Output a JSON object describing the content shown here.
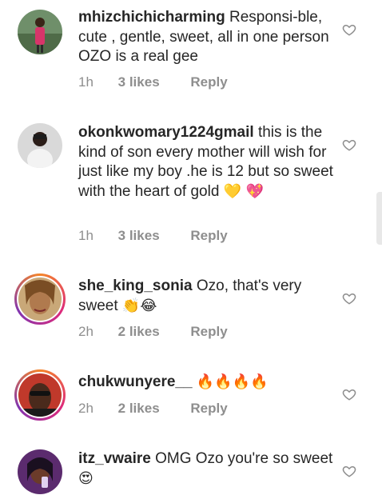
{
  "comments": [
    {
      "username": "mhizchichicharming",
      "text": "Responsi-ble, cute , gentle, sweet, all in one person OZO is a real gee",
      "time": "1h",
      "likes": "3 likes",
      "reply": "Reply"
    },
    {
      "username": "okonkwomary1224gmail",
      "text": "this is the kind of son every mother will wish for  just like  my boy .he is 12 but so sweet with the heart of gold",
      "emoji": "💛 💖",
      "time": "1h",
      "likes": "3 likes",
      "reply": "Reply"
    },
    {
      "username": "she_king_sonia",
      "text": "Ozo, that's very sweet",
      "emoji": "👏😂",
      "time": "2h",
      "likes": "2 likes",
      "reply": "Reply"
    },
    {
      "username": "chukwunyere__",
      "text": "",
      "emoji": "🔥🔥🔥🔥",
      "time": "2h",
      "likes": "2 likes",
      "reply": "Reply"
    },
    {
      "username": "itz_vwaire",
      "text": "OMG Ozo you're so sweet",
      "emoji": "😍",
      "time": "",
      "likes": "",
      "reply": ""
    }
  ],
  "colors": {
    "text": "#262626",
    "meta": "#8e8e8e",
    "heart_outline": "#8e8e8e",
    "story_ring": [
      "#f58529",
      "#dd2a7b",
      "#8134af"
    ]
  },
  "icons": {
    "like": "heart-outline-icon"
  }
}
